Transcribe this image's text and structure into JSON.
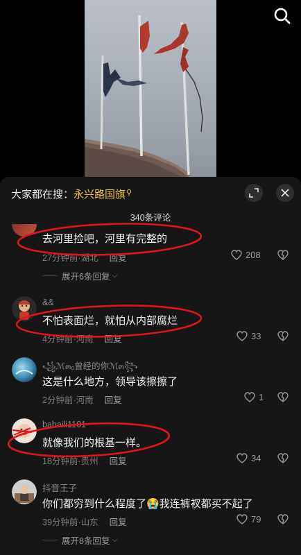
{
  "search_hint": {
    "prefix": "大家都在搜：",
    "keyword": "永兴路国旗"
  },
  "comment_count": "340条评论",
  "comments": [
    {
      "username": "",
      "text": "去河里捡吧，河里有完整的",
      "time": "27分钟前",
      "location": "湖北",
      "reply": "回复",
      "likes": "208",
      "replies": "展开6条回复"
    },
    {
      "username": "&&",
      "text": "不怕表面烂，就怕从内部腐烂",
      "time": "4分钟前",
      "location": "河南",
      "reply": "回复",
      "likes": "33"
    },
    {
      "username": "꧁ℳ๓ₒ曾经的你ℳ๓꧂",
      "text": "这是什么地方，领导该擦擦了",
      "time": "2分钟前",
      "location": "河南",
      "reply": "回复",
      "likes": "1"
    },
    {
      "username": "babaili1101",
      "text": "就像我们的根基一样。",
      "time": "18分钟前",
      "location": "贵州",
      "reply": "回复",
      "likes": "34"
    },
    {
      "username": "抖音王子",
      "text": "你们都穷到什么程度了😭我连裤衩都买不起了",
      "time": "39分钟前",
      "location": "山东",
      "reply": "回复",
      "likes": "79",
      "replies": "展开8条回复"
    }
  ],
  "meta_separator": "·",
  "icons": {
    "search": "search-icon",
    "expand": "expand-icon",
    "close": "close-icon",
    "like": "heart-outline-icon",
    "dislike": "broken-heart-icon"
  },
  "colors": {
    "sheet_bg": "#161616",
    "keyword": "#f5c242",
    "annotation_red": "#e0141e"
  }
}
